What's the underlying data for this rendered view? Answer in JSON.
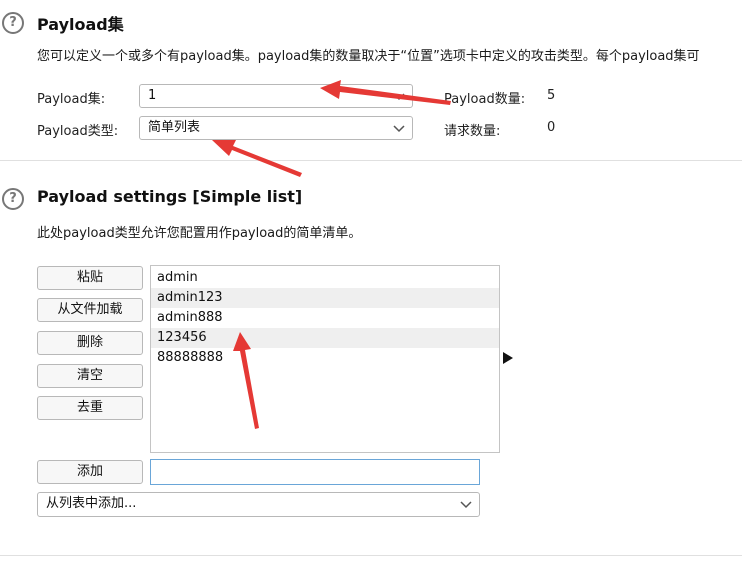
{
  "payload_sets": {
    "help_icon": "question-circle-icon",
    "title": "Payload集",
    "description": "您可以定义一个或多个有payload集。payload集的数量取决于“位置”选项卡中定义的攻击类型。每个payload集可",
    "set_label": "Payload集:",
    "set_value": "1",
    "type_label": "Payload类型:",
    "type_value": "简单列表",
    "count_label": "Payload数量:",
    "count_value": "5",
    "request_label": "请求数量:",
    "request_value": "0"
  },
  "payload_settings": {
    "help_icon": "question-circle-icon",
    "title": "Payload settings [Simple list]",
    "description": "此处payload类型允许您配置用作payload的简单清单。",
    "buttons": {
      "paste": "粘贴",
      "load": "从文件加载",
      "remove": "删除",
      "clear": "清空",
      "dedupe": "去重",
      "add": "添加"
    },
    "items": [
      "admin",
      "admin123",
      "admin888",
      "123456",
      "88888888"
    ],
    "add_input_value": "",
    "add_from_list": "从列表中添加..."
  },
  "colors": {
    "annotation_arrow": "#e53935",
    "input_focus_border": "#6aa6d8"
  }
}
